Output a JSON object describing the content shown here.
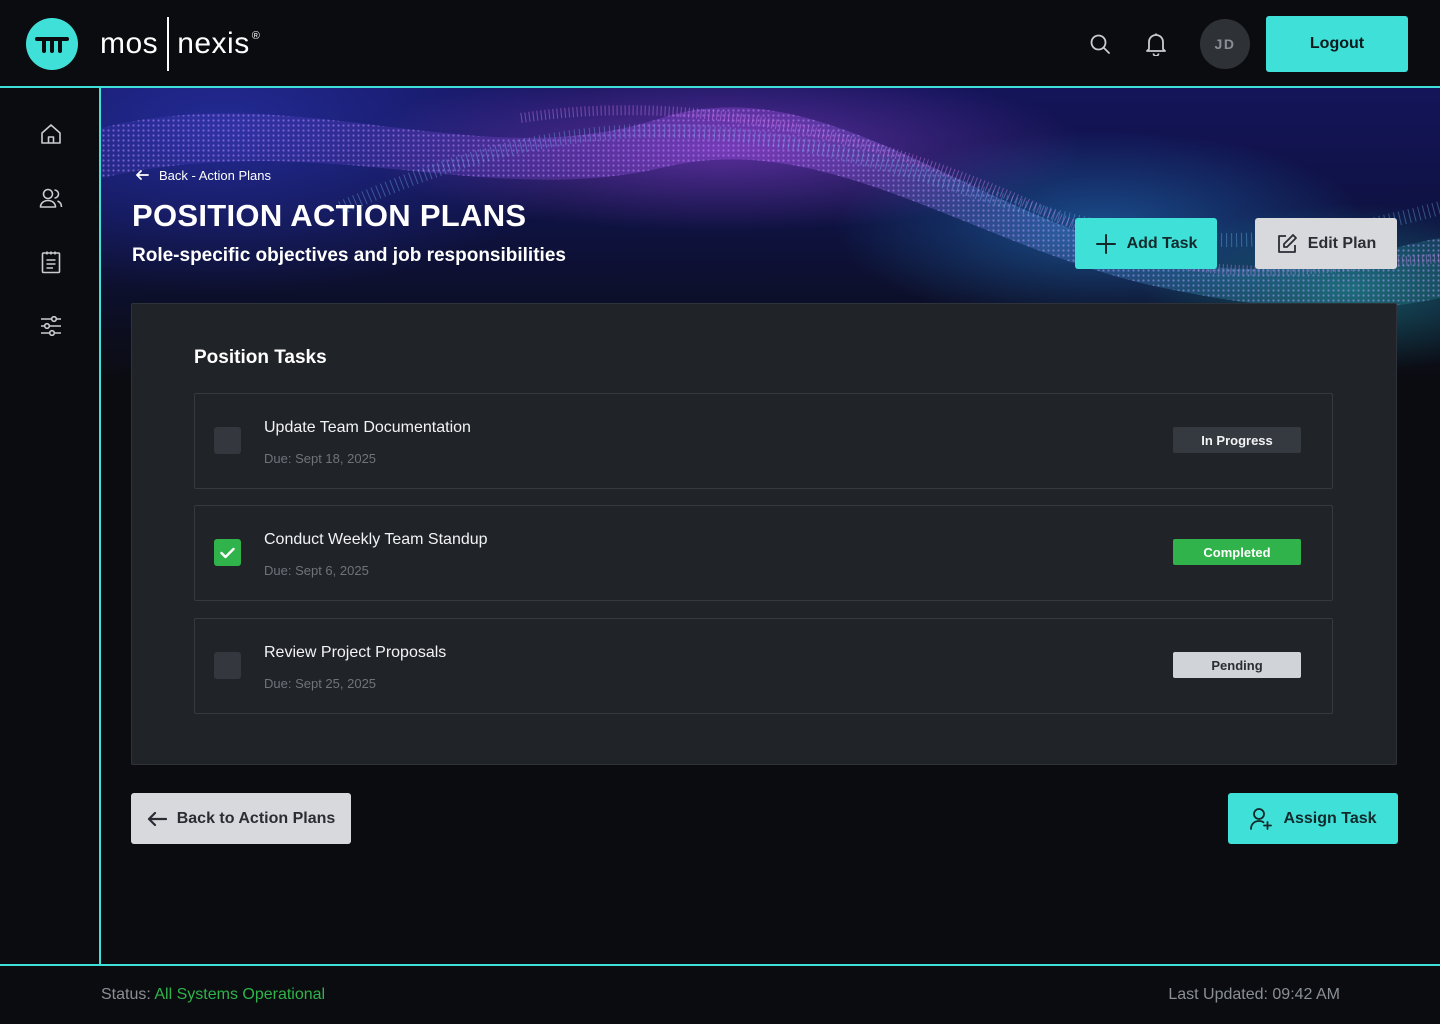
{
  "brand": {
    "part1": "mos",
    "part2": "nexis",
    "registered": "®"
  },
  "header": {
    "avatar_initials": "JD",
    "logout_label": "Logout",
    "icons": [
      "search-icon",
      "bell-icon"
    ]
  },
  "sidebar": {
    "items": [
      {
        "icon": "home-icon"
      },
      {
        "icon": "users-icon"
      },
      {
        "icon": "clipboard-icon"
      },
      {
        "icon": "sliders-icon"
      }
    ]
  },
  "hero": {
    "back_label": "Back - Action Plans",
    "title": "POSITION ACTION PLANS",
    "subtitle": "Role-specific objectives and job responsibilities",
    "add_task_label": "Add Task",
    "edit_plan_label": "Edit Plan"
  },
  "card": {
    "title": "Position Tasks",
    "tasks": [
      {
        "name": "Update Team Documentation",
        "due": "Due: Sept 18, 2025",
        "status": "In Progress",
        "checked": false
      },
      {
        "name": "Conduct Weekly Team Standup",
        "due": "Due: Sept 6, 2025",
        "status": "Completed",
        "checked": true
      },
      {
        "name": "Review Project Proposals",
        "due": "Due: Sept 25, 2025",
        "status": "Pending",
        "checked": false
      }
    ]
  },
  "actions": {
    "back_label": "Back to Action Plans",
    "assign_label": "Assign Task"
  },
  "footer": {
    "status_label": "Status:",
    "status_value": "All Systems Operational",
    "updated": "Last Updated: 09:42 AM"
  },
  "colors": {
    "accent": "#3fe0d8",
    "success": "#2fb34a",
    "background": "#0b0c0f",
    "card": "#202327"
  }
}
